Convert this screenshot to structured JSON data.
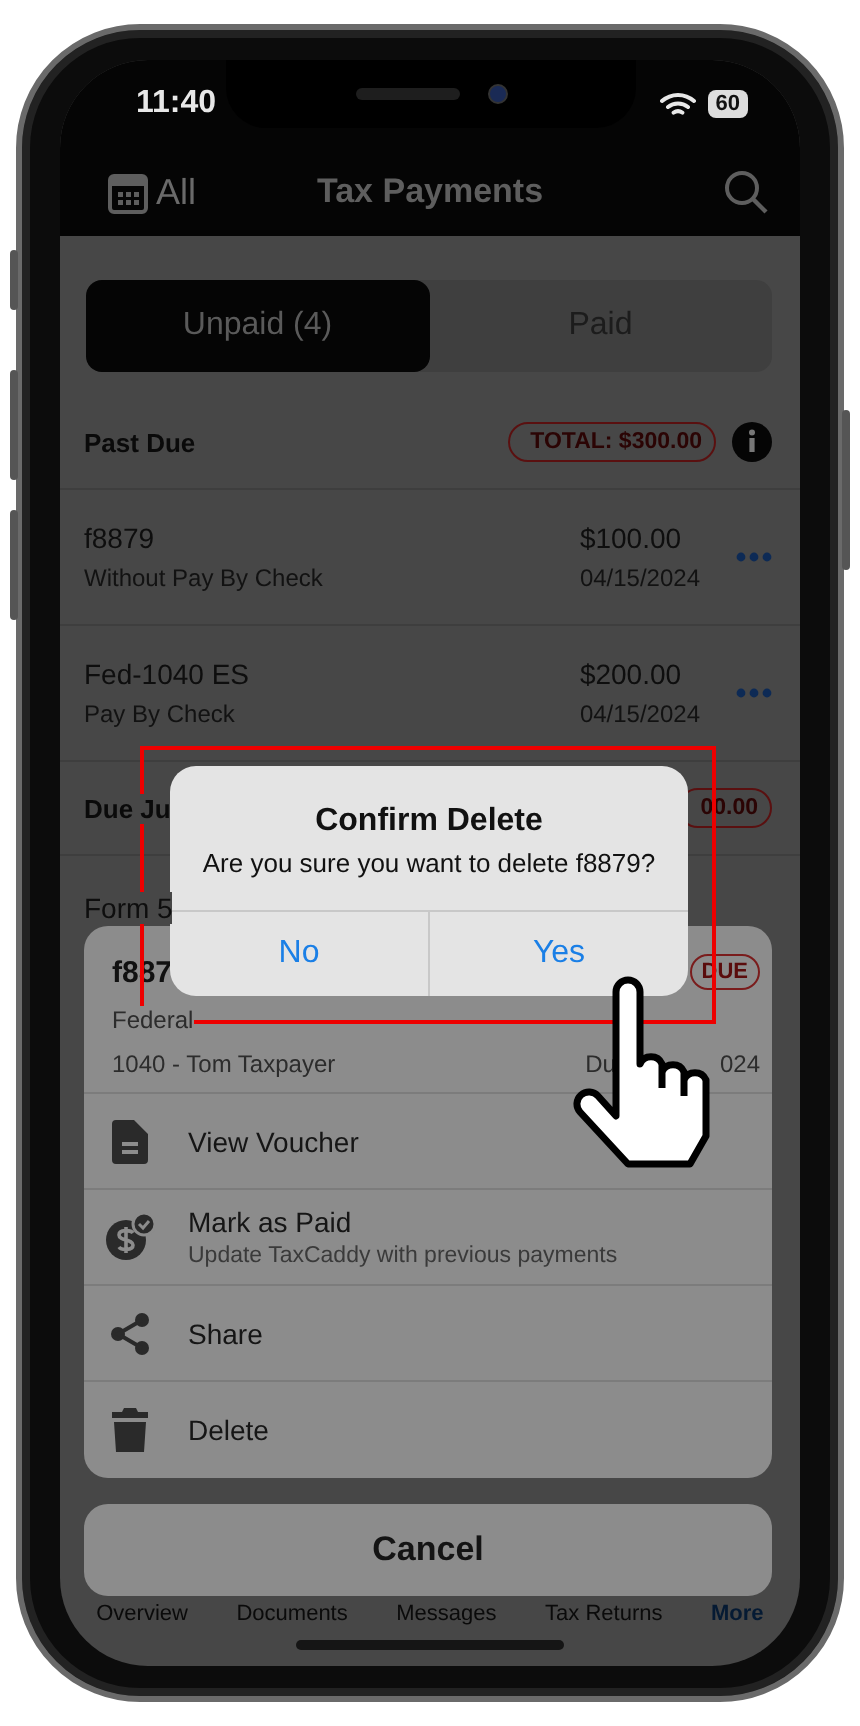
{
  "status_bar": {
    "time": "11:40",
    "battery": "60"
  },
  "nav": {
    "filter": "All",
    "title": "Tax Payments"
  },
  "segments": [
    {
      "label": "Unpaid (4)",
      "selected": true
    },
    {
      "label": "Paid",
      "selected": false
    }
  ],
  "sections": [
    {
      "title": "Past Due",
      "total": "TOTAL: $300.00",
      "items": [
        {
          "name": "f8879",
          "subtitle": "Without Pay By Check",
          "amount": "$100.00",
          "date": "04/15/2024"
        },
        {
          "name": "Fed-1040 ES",
          "subtitle": "Pay By Check",
          "amount": "$200.00",
          "date": "04/15/2024"
        }
      ]
    },
    {
      "title": "Due Ju",
      "total": "00.00",
      "items": [
        {
          "name": "Form 5"
        }
      ]
    }
  ],
  "action_sheet": {
    "header": {
      "name": "f887",
      "badge": "DUE",
      "type": "Federal",
      "owner": "1040 - Tom Taxpayer",
      "due_start": "Du",
      "due_end": "024"
    },
    "items": [
      {
        "kind": "voucher",
        "label": "View Voucher"
      },
      {
        "kind": "paid",
        "label": "Mark as Paid",
        "subtitle": "Update TaxCaddy with previous payments"
      },
      {
        "kind": "share",
        "label": "Share"
      },
      {
        "kind": "delete",
        "label": "Delete"
      }
    ],
    "cancel": "Cancel"
  },
  "dialog": {
    "title": "Confirm Delete",
    "message": "Are you sure you want to delete f8879?",
    "buttons": [
      "No",
      "Yes"
    ]
  },
  "tab_bar": [
    {
      "label": "Overview",
      "selected": false
    },
    {
      "label": "Documents",
      "selected": false
    },
    {
      "label": "Messages",
      "selected": false
    },
    {
      "label": "Tax Returns",
      "selected": false
    },
    {
      "label": "More",
      "selected": true
    }
  ]
}
